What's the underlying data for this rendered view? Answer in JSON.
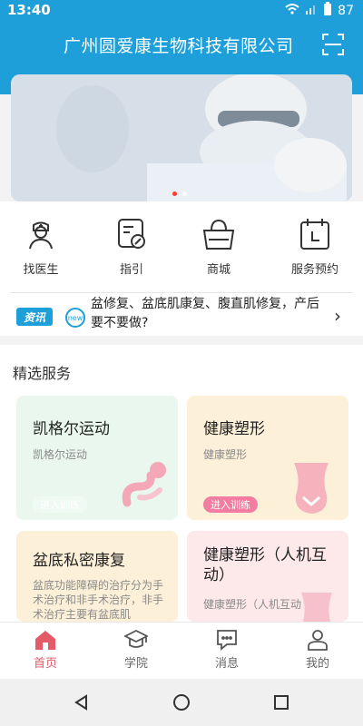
{
  "status": {
    "time": "13:40",
    "battery": "87"
  },
  "header": {
    "title": "广州圆爱康生物科技有限公司"
  },
  "banner": {
    "dots": 2,
    "active_dot": 1
  },
  "quick_actions": [
    {
      "label": "找医生",
      "icon": "doctor-icon"
    },
    {
      "label": "指引",
      "icon": "guide-icon"
    },
    {
      "label": "商城",
      "icon": "shop-bag-icon"
    },
    {
      "label": "服务预约",
      "icon": "calendar-icon"
    }
  ],
  "news": {
    "badge": "资讯",
    "new_tag": "new",
    "text": "盆修复、盆底肌康复、腹直肌修复，产后要不要做?"
  },
  "section": {
    "title": "精选服务"
  },
  "cards": [
    {
      "title": "凯格尔运动",
      "subtitle": "凯格尔运动",
      "button": "进入训练"
    },
    {
      "title": "健康塑形",
      "subtitle": "健康塑形",
      "button": "进入训练"
    },
    {
      "title": "盆底私密康复",
      "subtitle": "盆底功能障碍的治疗分为手术治疗和非手术治疗，非手术治疗主要有盆底肌"
    },
    {
      "title": "健康塑形（人机互动）",
      "subtitle": "健康塑形（人机互动"
    }
  ],
  "bottom_nav": [
    {
      "label": "首页",
      "icon": "home-icon",
      "active": true
    },
    {
      "label": "学院",
      "icon": "graduation-cap-icon",
      "active": false
    },
    {
      "label": "消息",
      "icon": "message-icon",
      "active": false
    },
    {
      "label": "我的",
      "icon": "profile-icon",
      "active": false
    }
  ],
  "colors": {
    "primary": "#1e9fda",
    "accent": "#e45a67",
    "card_green": "#e9f7ee",
    "card_orange": "#fdf0d9",
    "card_pink": "#fde8ea"
  }
}
